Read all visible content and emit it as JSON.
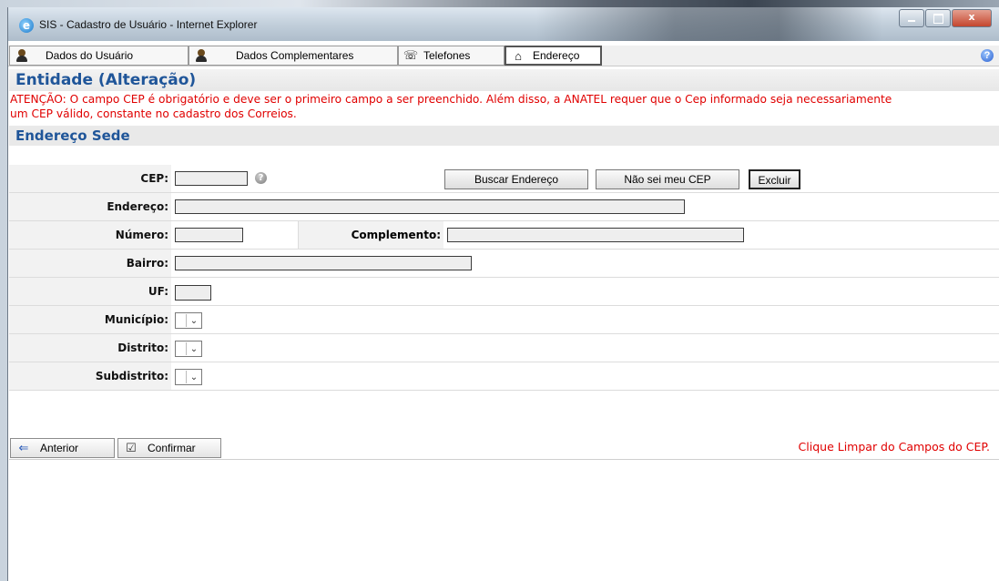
{
  "window": {
    "title": "SIS - Cadastro de Usuário - Internet Explorer",
    "icon": "internet-explorer-icon"
  },
  "tabs": [
    {
      "label": "Dados do Usuário",
      "icon": "user-icon",
      "active": false
    },
    {
      "label": "Dados Complementares",
      "icon": "user-icon",
      "active": false
    },
    {
      "label": "Telefones",
      "icon": "phone-icon",
      "active": false
    },
    {
      "label": "Endereço",
      "icon": "house-icon",
      "active": true
    }
  ],
  "page": {
    "title": "Entidade (Alteração)",
    "warning_line1": "ATENÇÃO: O campo CEP é obrigatório e deve ser o primeiro campo a ser preenchido. Além disso, a ANATEL requer que o Cep informado seja necessariamente",
    "warning_line2": "um CEP válido, constante no cadastro dos Correios.",
    "section_title": "Endereço Sede"
  },
  "form": {
    "cep_label": "CEP:",
    "cep_value": "",
    "buscar_button": "Buscar Endereço",
    "nao_sei_button": "Não sei meu CEP",
    "excluir_button": "Excluir",
    "endereco_label": "Endereço:",
    "endereco_value": "",
    "numero_label": "Número:",
    "numero_value": "",
    "complemento_label": "Complemento:",
    "complemento_value": "",
    "bairro_label": "Bairro:",
    "bairro_value": "",
    "uf_label": "UF:",
    "uf_value": "",
    "municipio_label": "Município:",
    "distrito_label": "Distrito:",
    "subdistrito_label": "Subdistrito:"
  },
  "footer": {
    "anterior_label": "Anterior",
    "confirmar_label": "Confirmar",
    "message": "Clique Limpar do Campos do CEP."
  },
  "colors": {
    "accent_blue": "#1f5599",
    "warning_red": "#e00000"
  }
}
